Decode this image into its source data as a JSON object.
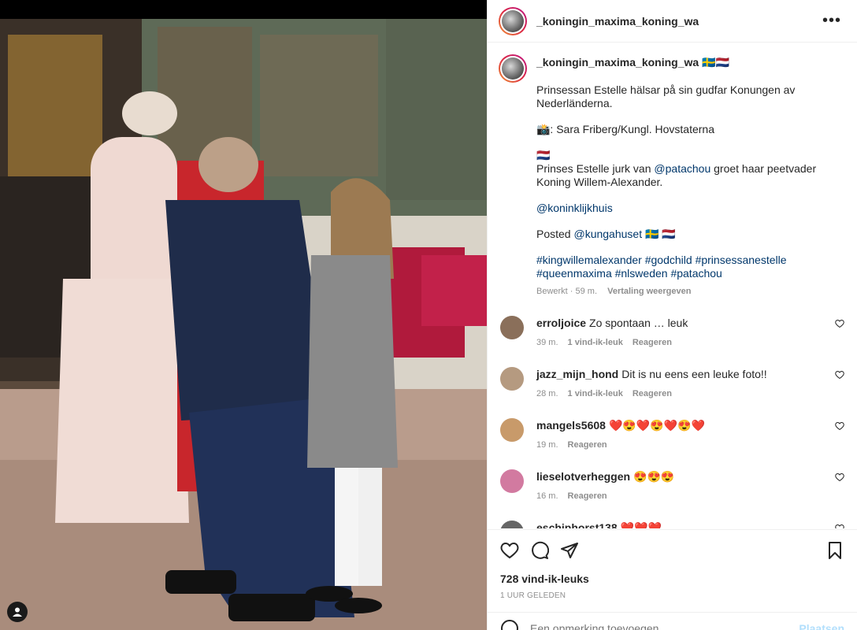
{
  "header": {
    "username": "_koningin_maxima_koning_wa",
    "more_label": "•••"
  },
  "caption": {
    "username": "_koningin_maxima_koning_wa",
    "flags": "🇸🇪🇳🇱",
    "line1": "Prinsessan Estelle hälsar på sin gudfar Konungen av Nederländerna.",
    "photo_credit": "📸: Sara Friberg/Kungl. Hovstaterna",
    "nl_flag": "🇳🇱",
    "line2_pre": "Prinses Estelle jurk van ",
    "line2_mention": "@patachou",
    "line2_post": " groet haar peetvader Koning Willem-Alexander.",
    "mention_koninklijkhuis": "@koninklijkhuis",
    "posted_pre": "Posted ",
    "posted_mention": "@kungahuset",
    "posted_flags": " 🇸🇪 🇳🇱",
    "hashtags": "#kingwillemalexander #godchild #prinsessanestelle #queenmaxima #nlsweden #patachou",
    "edited": "Bewerkt · 59 m.",
    "translate": "Vertaling weergeven"
  },
  "comments": [
    {
      "username": "erroljoice",
      "text": "Zo spontaan … leuk",
      "time": "39 m.",
      "likes": "1 vind-ik-leuk",
      "reply": "Reageren",
      "avatar_color": "#8a6f5a"
    },
    {
      "username": "jazz_mijn_hond",
      "text": "Dit is nu eens een leuke foto!!",
      "time": "28 m.",
      "likes": "1 vind-ik-leuk",
      "reply": "Reageren",
      "avatar_color": "#b59a80"
    },
    {
      "username": "mangels5608",
      "text": "❤️😍❤️😍❤️😍❤️",
      "time": "19 m.",
      "likes": "",
      "reply": "Reageren",
      "avatar_color": "#c89a6a"
    },
    {
      "username": "lieselotverheggen",
      "text": "😍😍😍",
      "time": "16 m.",
      "likes": "",
      "reply": "Reageren",
      "avatar_color": "#d27aa0"
    },
    {
      "username": "eschiphorst138",
      "text": "❤️❤️❤️",
      "time": "",
      "likes": "",
      "reply": "",
      "avatar_color": "#666666"
    }
  ],
  "actions": {
    "likes": "728 vind-ik-leuks",
    "time": "1 UUR GELEDEN"
  },
  "comment_input": {
    "placeholder": "Een opmerking toevoegen...",
    "post_label": "Plaatsen"
  }
}
